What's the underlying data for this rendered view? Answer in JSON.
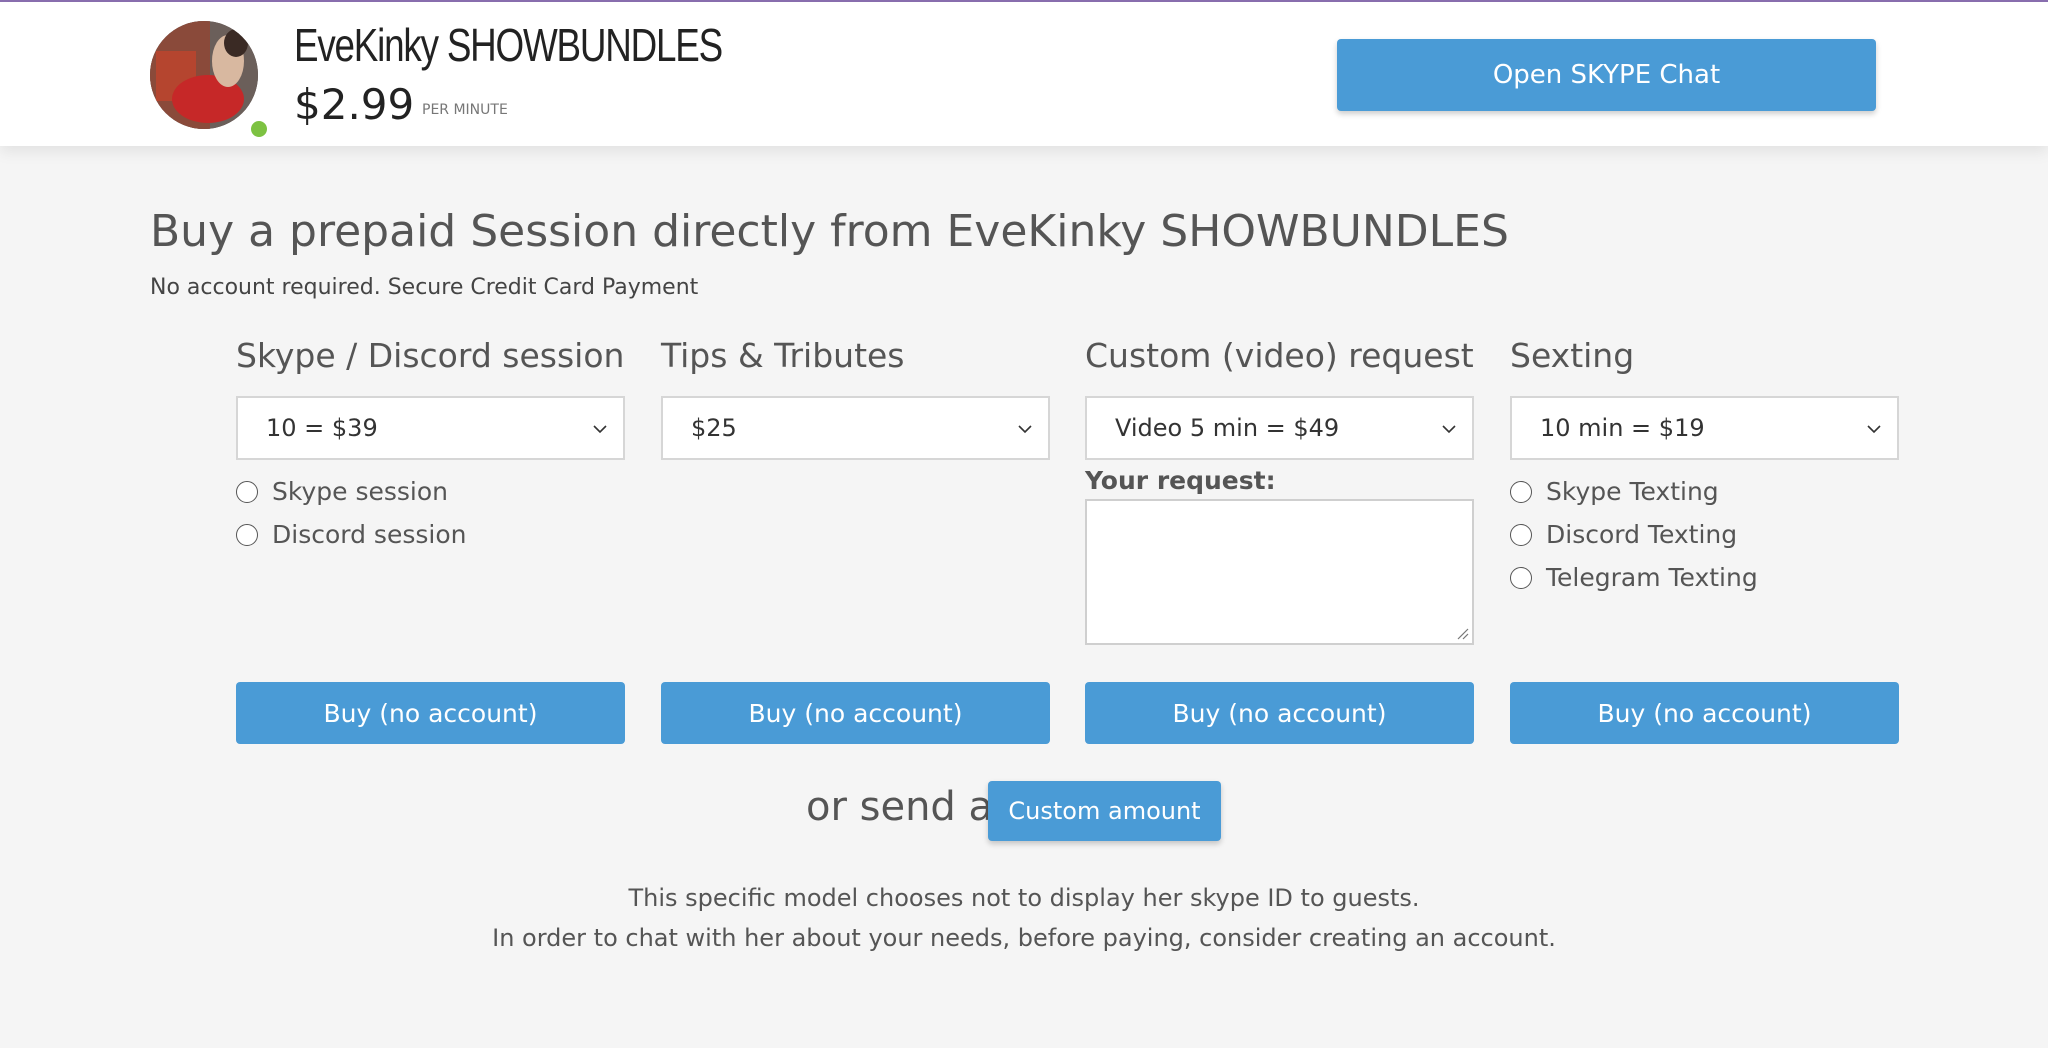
{
  "header": {
    "model_name": "EveKinky SHOWBUNDLES",
    "price": "$2.99",
    "price_unit": "PER MINUTE",
    "online_status_color": "#7dc242",
    "open_chat_label": "Open SKYPE Chat"
  },
  "main": {
    "headline": "Buy a prepaid Session directly from EveKinky SHOWBUNDLES",
    "subline": "No account required. Secure Credit Card Payment",
    "columns": [
      {
        "title": "Skype / Discord session",
        "selected_option": "10 = $39",
        "radios": [
          "Skype session",
          "Discord session"
        ],
        "buy_label": "Buy (no account)"
      },
      {
        "title": "Tips & Tributes",
        "selected_option": "$25",
        "buy_label": "Buy (no account)"
      },
      {
        "title": "Custom (video) request",
        "selected_option": "Video 5 min = $49",
        "request_label": "Your request:",
        "request_value": "",
        "buy_label": "Buy (no account)"
      },
      {
        "title": "Sexting",
        "selected_option": "10 min = $19",
        "radios": [
          "Skype Texting",
          "Discord Texting",
          "Telegram Texting"
        ],
        "buy_label": "Buy (no account)"
      }
    ],
    "or_send_text": "or send a",
    "custom_amount_label": "Custom amount",
    "info_line_1": "This specific model chooses not to display her skype ID to guests.",
    "info_line_2": "In order to chat with her about your needs, before paying, consider creating an account."
  },
  "colors": {
    "accent": "#4a9bd6",
    "background": "#f5f5f5",
    "header_background": "#ffffff"
  }
}
